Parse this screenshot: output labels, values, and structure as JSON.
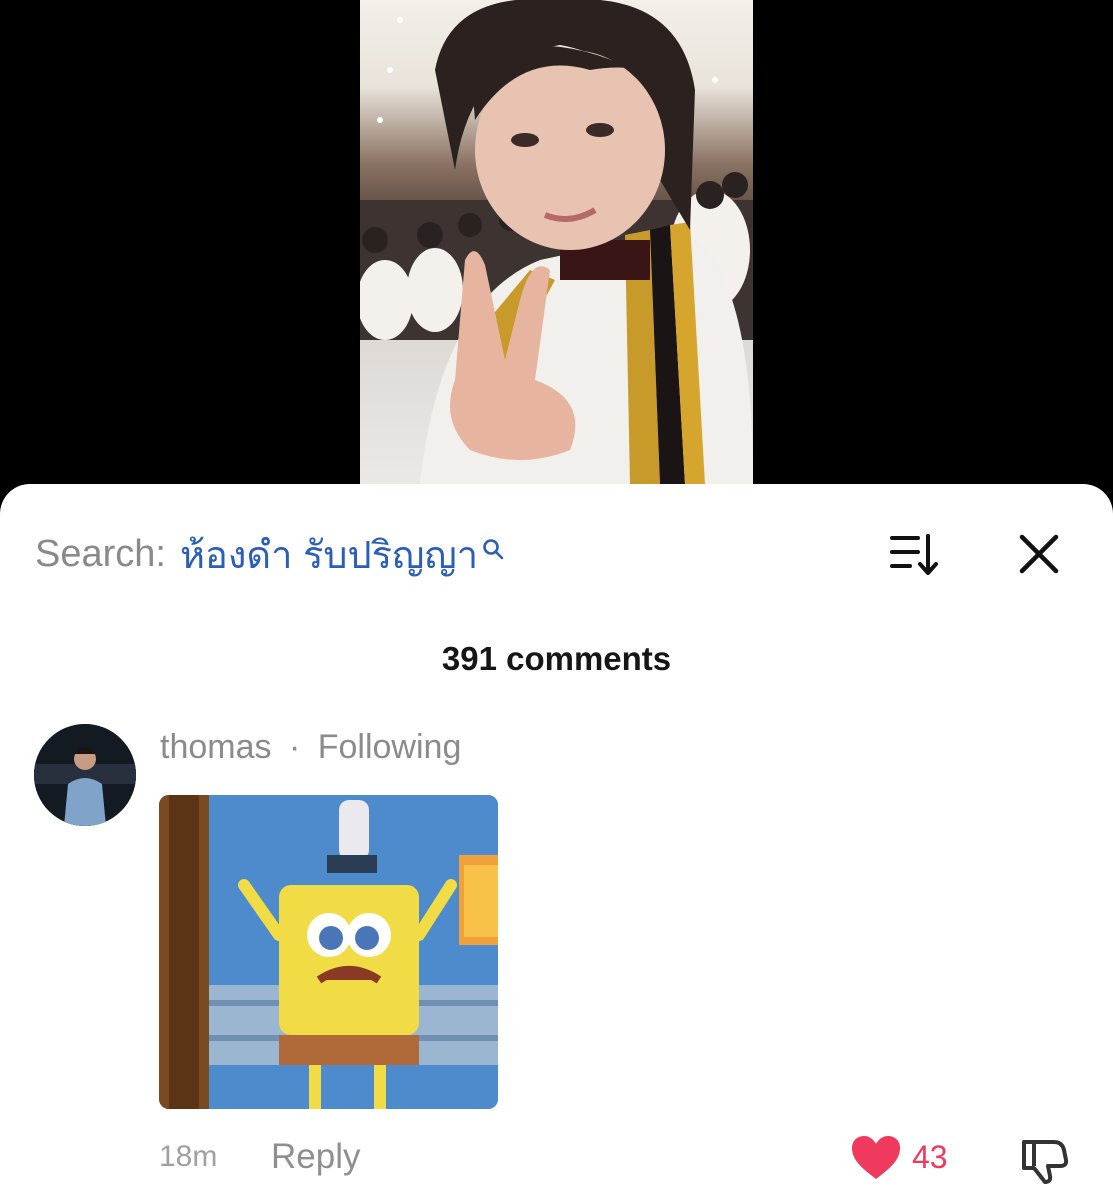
{
  "search": {
    "label": "Search:",
    "query": "ห้องดำ รับปริญญา"
  },
  "comments": {
    "count_text": "391 comments"
  },
  "comment": {
    "username": "thomas",
    "separator": "·",
    "relation": "Following",
    "time": "18m",
    "reply_label": "Reply",
    "like_count": "43"
  },
  "colors": {
    "search_query": "#2a5eb8",
    "like": "#ef3a5d",
    "sheet_background": "#ffffff",
    "video_background": "#000000"
  },
  "icons": {
    "search": "search-icon",
    "sort": "sort-icon",
    "close": "close-icon",
    "like": "heart-icon",
    "dislike": "thumbs-down-icon"
  }
}
